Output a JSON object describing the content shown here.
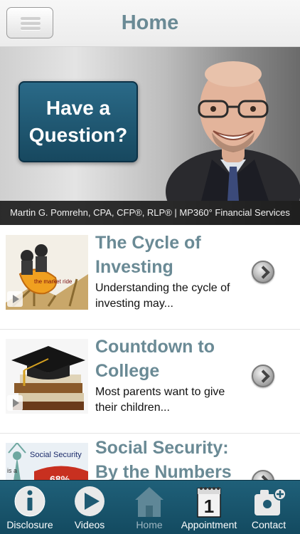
{
  "header": {
    "title": "Home"
  },
  "banner": {
    "question": "Have a\nQuestion?",
    "caption": "Martin G. Pomrehn, CPA, CFP®, RLP® | MP360° Financial Services"
  },
  "items": [
    {
      "title": "The Cycle of Investing",
      "description": "Understanding the cycle of investing may..."
    },
    {
      "title": "Countdown to College",
      "description": "Most parents want to give their children..."
    },
    {
      "title": "Social Security: By the Numbers",
      "description": ""
    }
  ],
  "thumb_text": {
    "cycle": "the market ride",
    "social_security": "Social Security",
    "social_security_prefix": "is a",
    "percent": "68%"
  },
  "tabs": [
    {
      "label": "Disclosure",
      "icon": "info-icon"
    },
    {
      "label": "Videos",
      "icon": "play-icon"
    },
    {
      "label": "Home",
      "icon": "home-icon",
      "active": true
    },
    {
      "label": "Appointment",
      "icon": "calendar-icon"
    },
    {
      "label": "Contact",
      "icon": "contact-icon"
    }
  ],
  "colors": {
    "accent": "#6a8a95",
    "tabbar": "#1a566d",
    "question_box": "#1f5a75"
  }
}
